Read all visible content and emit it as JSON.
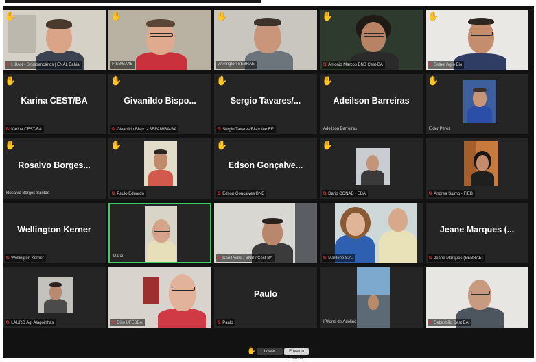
{
  "window": {
    "title": "Zoom meeting gallery view"
  },
  "tiles": [
    {
      "label": "LIBAN - Sindibancários | ENAL Bahia",
      "big_name": ""
    },
    {
      "label": "FIEB/BA4E",
      "big_name": ""
    },
    {
      "label": "Wellington SEBRAE",
      "big_name": ""
    },
    {
      "label": "Antonio Marcos BNB Cest-BA",
      "big_name": ""
    },
    {
      "label": "Sidnei Agro Bio",
      "big_name": ""
    },
    {
      "label": "Karina CEST/BA",
      "big_name": "Karina CEST/BA"
    },
    {
      "label": "Givanildo Bispo - SEFAM/BA-BA",
      "big_name": "Givanildo  Bispo..."
    },
    {
      "label": "Sergio Tavares/Bispo/ee EE",
      "big_name": "Sergio  Tavares/..."
    },
    {
      "label": "Adeilson Barreiras",
      "big_name": "Adeilson  Barreiras"
    },
    {
      "label": "Elder Perez",
      "big_name": ""
    },
    {
      "label": "Rosalvo Borges Santos",
      "big_name": "Rosalvo   Borges..."
    },
    {
      "label": "Paulo Eduardo",
      "big_name": ""
    },
    {
      "label": "Edson Gonçalves BNB",
      "big_name": "Edson   Gonçalve..."
    },
    {
      "label": "Dario CONAB - EBA",
      "big_name": ""
    },
    {
      "label": "Andrea Saimo - FIEB",
      "big_name": ""
    },
    {
      "label": "Wellington Kerner",
      "big_name": "Wellington  Kerner"
    },
    {
      "label": "Dario",
      "big_name": ""
    },
    {
      "label": "Cao Pedro / BNB / Cest BA",
      "big_name": ""
    },
    {
      "label": "Marilene S.A.",
      "big_name": ""
    },
    {
      "label": "Jeane Marques (SEBRAE)",
      "big_name": "Jeane  Marques  (..."
    },
    {
      "label": "LAURO Ag. Alagoinhas",
      "big_name": ""
    },
    {
      "label": "Dilio UFESBA",
      "big_name": ""
    },
    {
      "label": "Paulo",
      "big_name": "Paulo"
    },
    {
      "label": "iPhone de Adelino",
      "big_name": ""
    },
    {
      "label": "Sebastião Cest BA",
      "big_name": ""
    }
  ],
  "bottom_bar": {
    "lower_hand": "Lower",
    "self_name": "Edvaldo Santos"
  },
  "colors": {
    "background": "#121212",
    "tile": "#252525",
    "active_speaker": "#3ccf63",
    "hand": "#f6c343",
    "muted_mic": "#e0323a"
  },
  "icons": {
    "hand": "raised-hand-icon",
    "mic": "mic-muted-icon"
  }
}
